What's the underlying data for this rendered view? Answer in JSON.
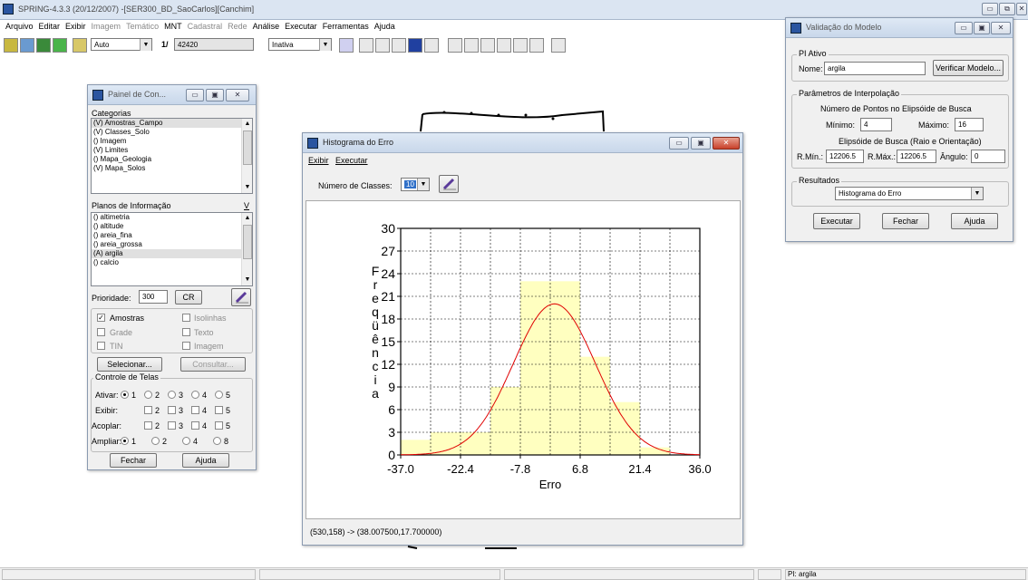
{
  "app": {
    "title": "SPRING-4.3.3 (20/12/2007) -[SER300_BD_SaoCarlos][Canchim]",
    "menu": [
      {
        "label": "Arquivo",
        "enabled": true
      },
      {
        "label": "Editar",
        "enabled": true
      },
      {
        "label": "Exibir",
        "enabled": true
      },
      {
        "label": "Imagem",
        "enabled": false
      },
      {
        "label": "Temático",
        "enabled": false
      },
      {
        "label": "MNT",
        "enabled": true
      },
      {
        "label": "Cadastral",
        "enabled": false
      },
      {
        "label": "Rede",
        "enabled": false
      },
      {
        "label": "Análise",
        "enabled": true
      },
      {
        "label": "Executar",
        "enabled": true
      },
      {
        "label": "Ferramentas",
        "enabled": true
      },
      {
        "label": "Ajuda",
        "enabled": true
      }
    ],
    "toolbar": {
      "scale_mode": "Auto",
      "scale_prefix": "1/",
      "scale_value": "42420",
      "state": "Inativa"
    },
    "status": {
      "pi": "PI: argila"
    }
  },
  "painel": {
    "title": "Painel de Con...",
    "categorias_label": "Categorias",
    "categorias": [
      "(V) Amostras_Campo",
      "(V) Classes_Solo",
      "() Imagem",
      "(V) Limites",
      "() Mapa_Geologia",
      "(V) Mapa_Solos"
    ],
    "planos_label": "Planos de Informação",
    "planos_v": "V",
    "planos": [
      "() altimetria",
      "() altitude",
      "() areia_fina",
      "() areia_grossa",
      "(A) argila",
      "() calcio"
    ],
    "prioridade_label": "Prioridade:",
    "prioridade_value": "300",
    "cr_label": "CR",
    "checks": {
      "amostras": "Amostras",
      "isolinhas": "Isolinhas",
      "grade": "Grade",
      "texto": "Texto",
      "tin": "TIN",
      "imagem": "Imagem"
    },
    "selecionar": "Selecionar...",
    "consultar": "Consultar...",
    "controle_label": "Controle de Telas",
    "ativar_label": "Ativar:",
    "exibir_label": "Exibir:",
    "acoplar_label": "Acoplar:",
    "ampliar_label": "Ampliar:",
    "n1": "1",
    "n2": "2",
    "n3": "3",
    "n4": "4",
    "n5": "5",
    "n8": "8",
    "fechar": "Fechar",
    "ajuda": "Ajuda"
  },
  "histograma": {
    "title": "Histograma do Erro",
    "menu": [
      "Exibir",
      "Executar"
    ],
    "num_classes_label": "Número de Classes:",
    "num_classes_value": "10",
    "status": "(530,158) -> (38.007500,17.700000)"
  },
  "chart_data": {
    "type": "bar",
    "xlabel": "Erro",
    "ylabel": "Freqüência",
    "xlim": [
      -37.0,
      36.0
    ],
    "ylim": [
      0,
      30
    ],
    "xticks": [
      "-37.0",
      "-22.4",
      "-7.8",
      "6.8",
      "21.4",
      "36.0"
    ],
    "yticks": [
      "0",
      "3",
      "6",
      "9",
      "12",
      "15",
      "18",
      "21",
      "24",
      "27",
      "30"
    ],
    "bin_edges": [
      -37.0,
      -29.7,
      -22.4,
      -15.1,
      -7.8,
      -0.5,
      6.8,
      14.1,
      21.4,
      28.7,
      36.0
    ],
    "values": [
      2,
      3,
      3,
      9,
      23,
      23,
      13,
      7,
      1,
      0
    ],
    "bar_color": "#ffffc0",
    "curve_color": "#e00000",
    "curve": {
      "type": "normal",
      "mean": 0.5,
      "sd": 10.0,
      "peak": 20.0
    },
    "grid": true
  },
  "validacao": {
    "title": "Validação do Modelo",
    "pi_ativo": "PI Ativo",
    "nome_label": "Nome:",
    "nome_value": "argila",
    "verificar": "Verificar Modelo...",
    "parametros_label": "Parâmetros de Interpolação",
    "num_pontos": "Número de Pontos no Elipsóide de Busca",
    "minimo_label": "Mínimo:",
    "minimo_value": "4",
    "maximo_label": "Máximo:",
    "maximo_value": "16",
    "elipsoide": "Elipsóide de Busca (Raio e Orientação)",
    "rmin_label": "R.Mín.:",
    "rmin_value": "12206.5",
    "rmax_label": "R.Máx.:",
    "rmax_value": "12206.5",
    "angulo_label": "Ângulo:",
    "angulo_value": "0",
    "resultados_label": "Resultados",
    "resultados_value": "Histograma do Erro",
    "executar": "Executar",
    "fechar": "Fechar",
    "ajuda": "Ajuda"
  }
}
